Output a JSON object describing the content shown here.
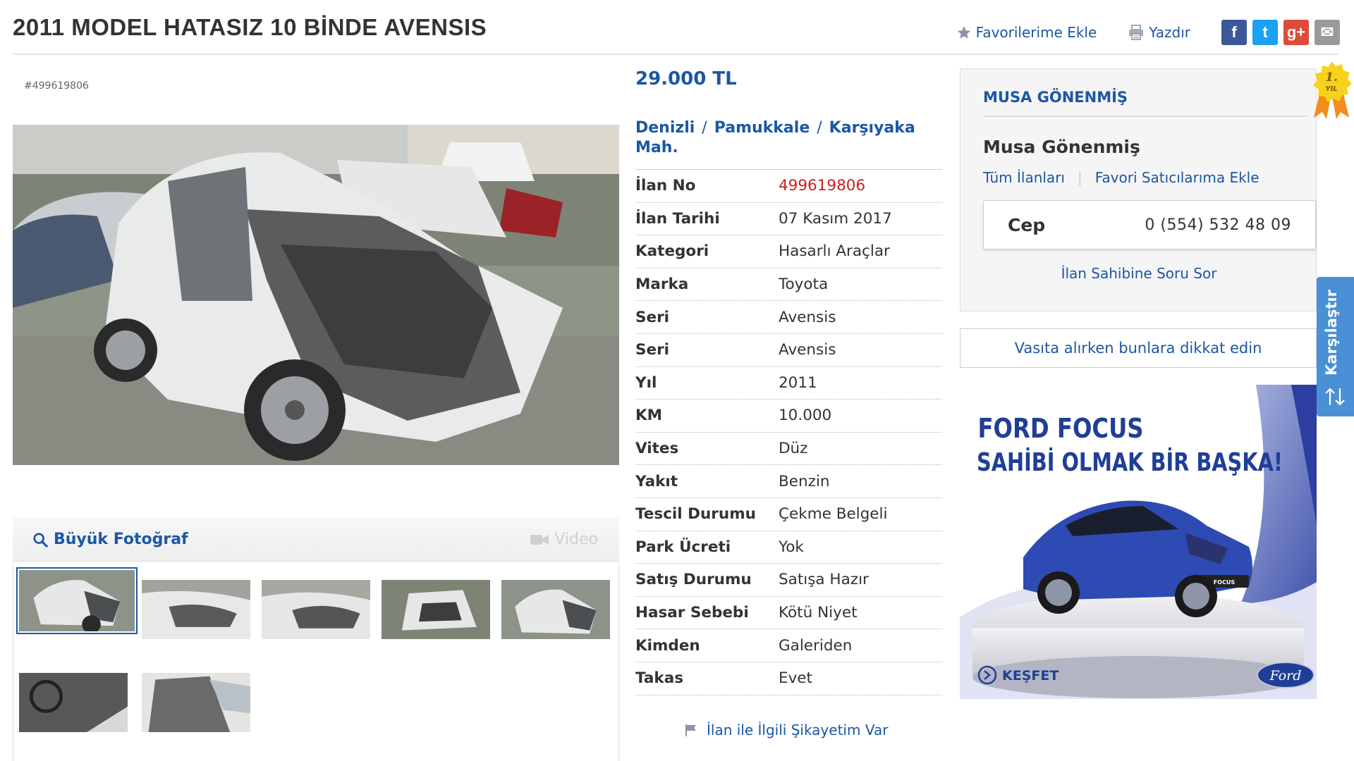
{
  "title": "2011 MODEL HATASIZ 10 BİNDE AVENSIS",
  "top_actions": {
    "favorite": "Favorilerime Ekle",
    "print": "Yazdır",
    "social": [
      {
        "name": "facebook",
        "glyph": "f",
        "color": "#3b5998"
      },
      {
        "name": "twitter",
        "glyph": "t",
        "color": "#1da1f2"
      },
      {
        "name": "google-plus",
        "glyph": "g+",
        "color": "#dd4b39"
      },
      {
        "name": "email",
        "glyph": "✉",
        "color": "#9a9a9a"
      }
    ]
  },
  "listing_code": "#499619806",
  "photo_bar": {
    "big_photo": "Büyük Fotoğraf",
    "video": "Video"
  },
  "price": "29.000 TL",
  "location": {
    "city": "Denizli",
    "district": "Pamukkale",
    "neighborhood": "Karşıyaka Mah."
  },
  "info": [
    {
      "key": "İlan No",
      "value": "499619806",
      "highlight": true
    },
    {
      "key": "İlan Tarihi",
      "value": "07 Kasım 2017"
    },
    {
      "key": "Kategori",
      "value": "Hasarlı Araçlar"
    },
    {
      "key": "Marka",
      "value": "Toyota"
    },
    {
      "key": "Seri",
      "value": "Avensis"
    },
    {
      "key": "Seri",
      "value": "Avensis"
    },
    {
      "key": "Yıl",
      "value": "2011"
    },
    {
      "key": "KM",
      "value": "10.000"
    },
    {
      "key": "Vites",
      "value": "Düz"
    },
    {
      "key": "Yakıt",
      "value": "Benzin"
    },
    {
      "key": "Tescil Durumu",
      "value": "Çekme Belgeli"
    },
    {
      "key": "Park Ücreti",
      "value": "Yok"
    },
    {
      "key": "Satış Durumu",
      "value": "Satışa Hazır"
    },
    {
      "key": "Hasar Sebebi",
      "value": "Kötü Niyet"
    },
    {
      "key": "Kimden",
      "value": "Galeriden"
    },
    {
      "key": "Takas",
      "value": "Evet"
    }
  ],
  "complaint": "İlan ile İlgili Şikayetim Var",
  "seller": {
    "header": "MUSA GÖNENMİŞ",
    "badge_top": "1.",
    "badge_bottom": "YIL",
    "name": "Musa Gönenmiş",
    "all_listings": "Tüm İlanları",
    "add_favorite_seller": "Favori Satıcılarıma Ekle",
    "phone_label": "Cep",
    "phone_number": "0 (554) 532 48 09",
    "ask_question": "İlan Sahibine Soru Sor"
  },
  "careful_link": "Vasıta alırken bunlara dikkat edin",
  "ad": {
    "headline1": "FORD FOCUS",
    "headline2": "SAHİBİ OLMAK BİR BAŞKA!",
    "cta": "KEŞFET",
    "brand": "Ford",
    "plate": "FOCUS"
  },
  "compare": "Karşılaştır",
  "colors": {
    "link": "#1b57a5",
    "red": "#d11d1d",
    "compare": "#4a90d6",
    "ford_blue": "#1f3f97"
  }
}
